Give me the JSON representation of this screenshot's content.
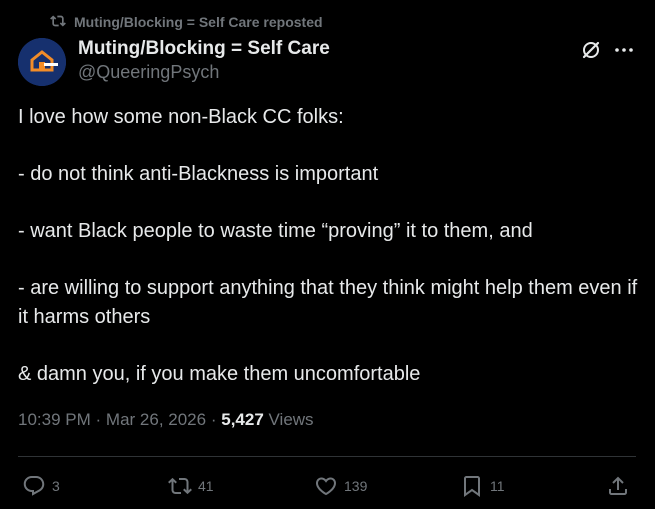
{
  "repost_header": {
    "icon": "repost-icon",
    "text": "Muting/Blocking = Self Care reposted"
  },
  "author": {
    "display_name": "Muting/Blocking = Self Care",
    "handle": "@QueeringPsych",
    "avatar": "avatar-logo"
  },
  "tweet": {
    "paragraphs": [
      "I love how some non-Black CC folks:",
      "- do not think anti-Blackness is important",
      "- want Black people to waste time “proving” it to them, and",
      "- are willing to support anything that they think might help them even if it harms others",
      "& damn you, if you make them uncomfortable"
    ]
  },
  "meta": {
    "time": "10:39 PM",
    "separator": "·",
    "date": "Mar 26, 2026",
    "views_count": "5,427",
    "views_label": "Views"
  },
  "actions": {
    "reply_count": "3",
    "repost_count": "41",
    "like_count": "139",
    "bookmark_count": "11"
  },
  "colors": {
    "background": "#000000",
    "text_primary": "#e7e9ea",
    "text_secondary": "#71767b",
    "divider": "#2f3336"
  }
}
